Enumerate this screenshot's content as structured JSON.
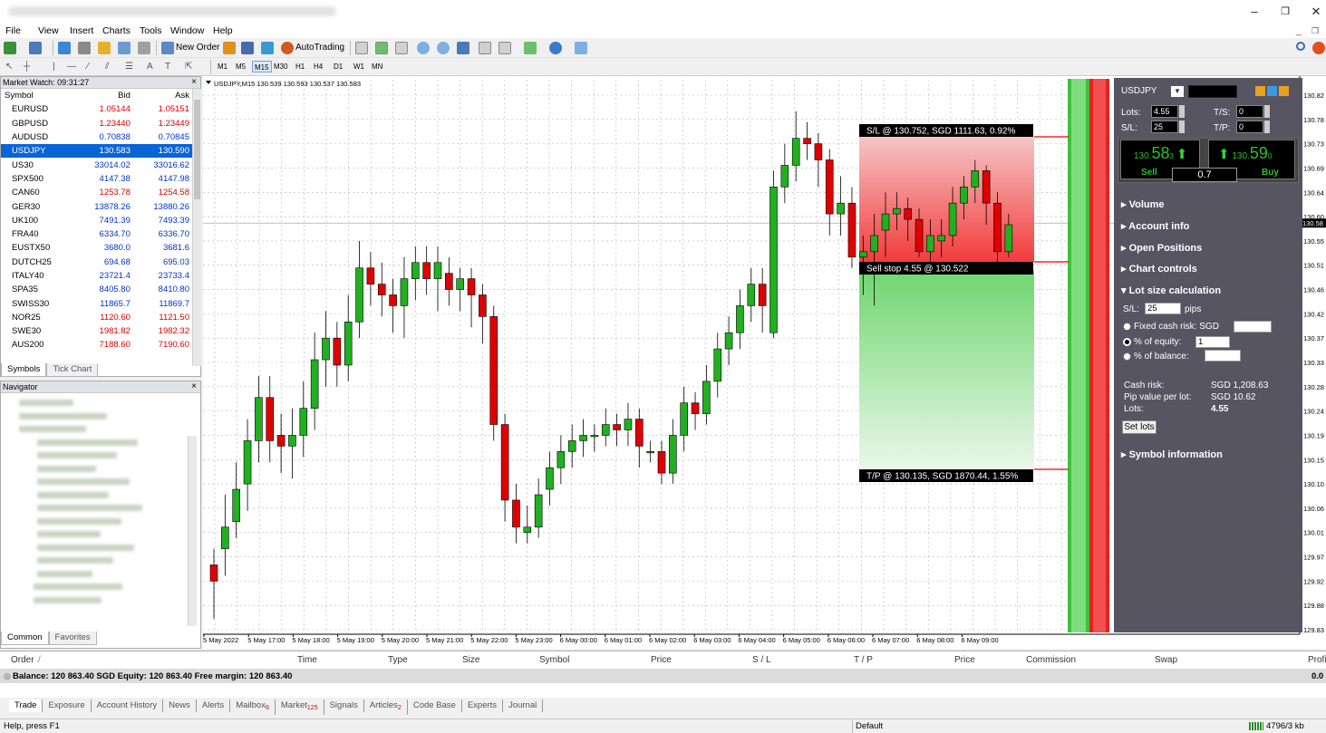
{
  "menu": [
    "File",
    "View",
    "Insert",
    "Charts",
    "Tools",
    "Window",
    "Help"
  ],
  "toolbar": {
    "new_order": "New Order",
    "autotrading": "AutoTrading"
  },
  "timeframes": [
    "M1",
    "M5",
    "M15",
    "M30",
    "H1",
    "H4",
    "D1",
    "W1",
    "MN"
  ],
  "active_timeframe": "M15",
  "market_watch": {
    "title": "Market Watch: 09:31:27",
    "columns": [
      "Symbol",
      "Bid",
      "Ask"
    ],
    "rows": [
      {
        "symbol": "EURUSD",
        "bid": "1.05144",
        "ask": "1.05151",
        "color": "red"
      },
      {
        "symbol": "GBPUSD",
        "bid": "1.23440",
        "ask": "1.23449",
        "color": "red"
      },
      {
        "symbol": "AUDUSD",
        "bid": "0.70838",
        "ask": "0.70845",
        "color": "blue"
      },
      {
        "symbol": "USDJPY",
        "bid": "130.583",
        "ask": "130.590",
        "color": "sel"
      },
      {
        "symbol": "US30",
        "bid": "33014.02",
        "ask": "33016.62",
        "color": "blue"
      },
      {
        "symbol": "SPX500",
        "bid": "4147.38",
        "ask": "4147.98",
        "color": "blue"
      },
      {
        "symbol": "CAN60",
        "bid": "1253.78",
        "ask": "1254.58",
        "color": "red"
      },
      {
        "symbol": "GER30",
        "bid": "13878.26",
        "ask": "13880.26",
        "color": "blue"
      },
      {
        "symbol": "UK100",
        "bid": "7491.39",
        "ask": "7493.39",
        "color": "blue"
      },
      {
        "symbol": "FRA40",
        "bid": "6334.70",
        "ask": "6336.70",
        "color": "blue"
      },
      {
        "symbol": "EUSTX50",
        "bid": "3680.0",
        "ask": "3681.6",
        "color": "blue"
      },
      {
        "symbol": "DUTCH25",
        "bid": "694.68",
        "ask": "695.03",
        "color": "blue"
      },
      {
        "symbol": "ITALY40",
        "bid": "23721.4",
        "ask": "23733.4",
        "color": "blue"
      },
      {
        "symbol": "SPA35",
        "bid": "8405.80",
        "ask": "8410.80",
        "color": "blue"
      },
      {
        "symbol": "SWISS30",
        "bid": "11865.7",
        "ask": "11869.7",
        "color": "blue"
      },
      {
        "symbol": "NOR25",
        "bid": "1120.60",
        "ask": "1121.50",
        "color": "red"
      },
      {
        "symbol": "SWE30",
        "bid": "1981.82",
        "ask": "1982.32",
        "color": "red"
      },
      {
        "symbol": "AUS200",
        "bid": "7188.60",
        "ask": "7190.60",
        "color": "red"
      }
    ],
    "tabs": [
      "Symbols",
      "Tick Chart"
    ]
  },
  "navigator": {
    "title": "Navigator",
    "tabs": [
      "Common",
      "Favorites"
    ]
  },
  "chart": {
    "header": "USDJPY,M15  130.539 130.593 130.537 130.583",
    "price_labels": [
      "130.82",
      "130.78",
      "130.73",
      "130.69",
      "130.64",
      "130.60",
      "130.55",
      "130.51",
      "130.46",
      "130.42",
      "130.37",
      "130.33",
      "130.28",
      "130.24",
      "130.19",
      "130.15",
      "130.10",
      "130.06",
      "130.01",
      "129.97",
      "129.92",
      "129.88",
      "129.83"
    ],
    "current_price": "130.58",
    "time_labels": [
      "5 May 2022",
      "5 May 17:00",
      "5 May 18:00",
      "5 May 19:00",
      "5 May 20:00",
      "5 May 21:00",
      "5 May 22:00",
      "5 May 23:00",
      "6 May 00:00",
      "6 May 01:00",
      "6 May 02:00",
      "6 May 03:00",
      "6 May 04:00",
      "6 May 05:00",
      "6 May 06:00",
      "6 May 07:00",
      "6 May 08:00",
      "6 May 09:00"
    ],
    "sl_label": "S/L @ 130.752, SGD 1111.63, 0.92%",
    "entry_label": "Sell stop 4.55 @ 130.522",
    "tp_label": "T/P @ 130.135, SGD 1870.44, 1.55%",
    "candles": [
      [
        129.95,
        129.92,
        129.98,
        129.85
      ],
      [
        129.98,
        130.02,
        130.08,
        129.93
      ],
      [
        130.03,
        130.09,
        130.14,
        130.0
      ],
      [
        130.1,
        130.18,
        130.22,
        130.05
      ],
      [
        130.18,
        130.26,
        130.3,
        130.14
      ],
      [
        130.26,
        130.18,
        130.3,
        130.14
      ],
      [
        130.19,
        130.17,
        130.23,
        130.12
      ],
      [
        130.17,
        130.19,
        130.24,
        130.11
      ],
      [
        130.19,
        130.24,
        130.29,
        130.15
      ],
      [
        130.24,
        130.33,
        130.38,
        130.2
      ],
      [
        130.33,
        130.37,
        130.42,
        130.28
      ],
      [
        130.37,
        130.32,
        130.4,
        130.28
      ],
      [
        130.32,
        130.4,
        130.45,
        130.29
      ],
      [
        130.4,
        130.5,
        130.55,
        130.37
      ],
      [
        130.5,
        130.47,
        130.53,
        130.43
      ],
      [
        130.47,
        130.45,
        130.51,
        130.41
      ],
      [
        130.45,
        130.43,
        130.48,
        130.38
      ],
      [
        130.43,
        130.48,
        130.52,
        130.37
      ],
      [
        130.48,
        130.51,
        130.54,
        130.44
      ],
      [
        130.51,
        130.48,
        130.54,
        130.45
      ],
      [
        130.48,
        130.51,
        130.54,
        130.42
      ],
      [
        130.49,
        130.46,
        130.52,
        130.43
      ],
      [
        130.46,
        130.48,
        130.5,
        130.42
      ],
      [
        130.48,
        130.45,
        130.5,
        130.39
      ],
      [
        130.45,
        130.41,
        130.47,
        130.36
      ],
      [
        130.41,
        130.21,
        130.43,
        130.18
      ],
      [
        130.21,
        130.07,
        130.23,
        130.03
      ],
      [
        130.07,
        130.02,
        130.1,
        129.99
      ],
      [
        130.01,
        130.02,
        130.06,
        129.99
      ],
      [
        130.02,
        130.08,
        130.11,
        130.0
      ],
      [
        130.09,
        130.13,
        130.16,
        130.06
      ],
      [
        130.13,
        130.16,
        130.19,
        130.1
      ],
      [
        130.16,
        130.18,
        130.21,
        130.13
      ],
      [
        130.18,
        130.19,
        130.22,
        130.15
      ],
      [
        130.19,
        130.19,
        130.21,
        130.16
      ],
      [
        130.19,
        130.21,
        130.24,
        130.17
      ],
      [
        130.21,
        130.2,
        130.23,
        130.17
      ],
      [
        130.2,
        130.22,
        130.25,
        130.17
      ],
      [
        130.22,
        130.17,
        130.24,
        130.13
      ],
      [
        130.16,
        130.16,
        130.18,
        130.14
      ],
      [
        130.16,
        130.12,
        130.18,
        130.1
      ],
      [
        130.12,
        130.19,
        130.22,
        130.1
      ],
      [
        130.19,
        130.25,
        130.28,
        130.16
      ],
      [
        130.25,
        130.23,
        130.27,
        130.2
      ],
      [
        130.23,
        130.29,
        130.32,
        130.21
      ],
      [
        130.29,
        130.35,
        130.38,
        130.26
      ],
      [
        130.35,
        130.38,
        130.41,
        130.32
      ],
      [
        130.38,
        130.43,
        130.46,
        130.35
      ],
      [
        130.43,
        130.47,
        130.5,
        130.4
      ],
      [
        130.47,
        130.43,
        130.5,
        130.38
      ],
      [
        130.38,
        130.65,
        130.68,
        130.37
      ],
      [
        130.65,
        130.69,
        130.73,
        130.62
      ],
      [
        130.69,
        130.74,
        130.79,
        130.66
      ],
      [
        130.74,
        130.73,
        130.77,
        130.7
      ],
      [
        130.73,
        130.7,
        130.75,
        130.65
      ],
      [
        130.7,
        130.6,
        130.72,
        130.56
      ],
      [
        130.6,
        130.62,
        130.67,
        130.56
      ],
      [
        130.62,
        130.52,
        130.65,
        130.5
      ],
      [
        130.52,
        130.53,
        130.56,
        130.45
      ],
      [
        130.53,
        130.56,
        130.6,
        130.43
      ],
      [
        130.57,
        130.6,
        130.64,
        130.52
      ],
      [
        130.6,
        130.61,
        130.64,
        130.57
      ],
      [
        130.61,
        130.59,
        130.63,
        130.55
      ],
      [
        130.59,
        130.53,
        130.61,
        130.52
      ],
      [
        130.53,
        130.56,
        130.59,
        130.51
      ],
      [
        130.55,
        130.56,
        130.59,
        130.52
      ],
      [
        130.56,
        130.62,
        130.65,
        130.54
      ],
      [
        130.62,
        130.65,
        130.67,
        130.59
      ],
      [
        130.65,
        130.68,
        130.7,
        130.62
      ],
      [
        130.68,
        130.62,
        130.69,
        130.58
      ],
      [
        130.62,
        130.53,
        130.64,
        130.51
      ],
      [
        130.53,
        130.58,
        130.6,
        130.52
      ]
    ]
  },
  "panel": {
    "symbol": "USDJPY",
    "lots_label": "Lots:",
    "lots": "4.55",
    "ts_label": "T/S:",
    "ts": "0",
    "sl_label": "S/L:",
    "sl": "25",
    "tp_label": "T/P:",
    "tp": "0",
    "sell_small": "130.",
    "sell_big": "58",
    "sell_sup": "3",
    "buy_small": "130.",
    "buy_big": "59",
    "buy_sup": "0",
    "sell_label": "Sell",
    "buy_label": "Buy",
    "spread": "0.7",
    "sections": [
      "Volume",
      "Account info",
      "Open Positions",
      "Chart controls"
    ],
    "lot_calc": "Lot size calculation",
    "lc_sl_label": "S/L:",
    "lc_sl": "25",
    "pips": "pips",
    "fixed": "Fixed cash risk: SGD",
    "equity": "% of equity:",
    "equity_val": "1",
    "balance": "% of balance:",
    "cash_risk_label": "Cash risk:",
    "cash_risk": "SGD 1,208.63",
    "pip_label": "Pip value per lot:",
    "pip_value": "SGD 10.62",
    "lots2_label": "Lots:",
    "lots2": "4.55",
    "set_lots": "Set lots",
    "symbol_info": "Symbol information"
  },
  "terminal": {
    "columns": [
      "Order",
      "Time",
      "Type",
      "Size",
      "Symbol",
      "Price",
      "S / L",
      "T / P",
      "Price",
      "Commission",
      "Swap",
      "Profi"
    ],
    "balance": "Balance: 120 863.40 SGD  Equity: 120 863.40  Free margin: 120 863.40",
    "balance_value": "0.0",
    "tabs": [
      {
        "label": "Trade",
        "sub": ""
      },
      {
        "label": "Exposure",
        "sub": ""
      },
      {
        "label": "Account History",
        "sub": ""
      },
      {
        "label": "News",
        "sub": ""
      },
      {
        "label": "Alerts",
        "sub": ""
      },
      {
        "label": "Mailbox",
        "sub": "6"
      },
      {
        "label": "Market",
        "sub": "125"
      },
      {
        "label": "Signals",
        "sub": ""
      },
      {
        "label": "Articles",
        "sub": "2"
      },
      {
        "label": "Code Base",
        "sub": ""
      },
      {
        "label": "Experts",
        "sub": ""
      },
      {
        "label": "Journal",
        "sub": ""
      }
    ]
  },
  "status": {
    "help": "Help, press F1",
    "profile": "Default",
    "traffic": "4796/3 kb"
  },
  "colors": {
    "bull": "#20b020",
    "bear": "#e00000",
    "panel": "#585562",
    "sl_zone": "#f25252",
    "tp_zone": "#7ed97e",
    "selected": "#0a64d6"
  }
}
